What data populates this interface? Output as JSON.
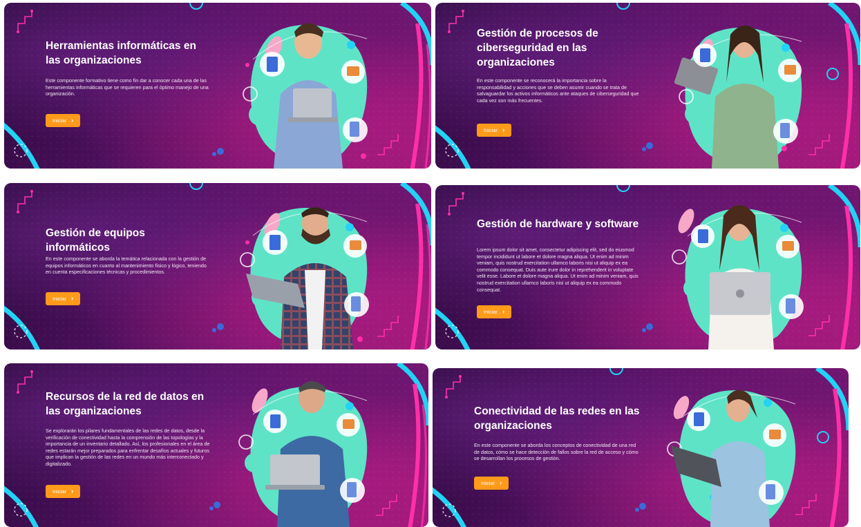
{
  "cards": [
    {
      "title": "Herramientas informáticas en las organizaciones",
      "description": "Este componente formativo tiene como fin dar a conocer cada una de las herramientas informáticas que se requieren para el óptimo manejo de una organización.",
      "button_label": "Iniciar"
    },
    {
      "title": "Gestión de procesos de ciberseguridad en las organizaciones",
      "description": "En este componente se reconocerá la importancia sobre la responsabilidad y acciones que se deben asumir cuando se trata de salvaguardar los activos informáticos ante ataques de ciberseguridad que cada vez son más frecuentes.",
      "button_label": "Iniciar"
    },
    {
      "title": "Gestión de equipos informáticos",
      "description": "En este componente se aborda la temática relacionada con la gestión de equipos informáticos en cuanto al mantenimiento físico y lógico, teniendo en cuenta especificaciones técnicas y procedimientos.",
      "button_label": "Iniciar"
    },
    {
      "title": "Gestión de hardware y software",
      "description": "Lorem ipsum dolor sit amet, consectetur adipiscing elit, sed do eiusmod tempor incididunt ut labore et dolore magna aliqua. Ut enim ad minim veniam, quis nostrud exercitation ullamco laboris nisi ut aliquip ex ea commodo consequat. Duis aute irure dolor in reprehenderit in voluptate velit esse.   Labore et dolore magna aliqua. Ut enim ad minim veniam, quis nostrud exercitation ullamco laboris nisi ut aliquip ex ea commodo consequat.",
      "button_label": "Iniciar"
    },
    {
      "title": "Recursos de la red de datos en las organizaciones",
      "description": "Se explorarán los pilares fundamentales de las redes de datos, desde la verificación de conectividad hasta la comprensión de las topologías y la importancia de un inventario detallado. Así, los profesionales en el área de redes estarán mejor preparados para enfrentar desafíos actuales y futuros que implican la gestión de las redes en un mundo más interconectado y digitalizado.",
      "button_label": "Iniciar"
    },
    {
      "title": "Conectividad de las redes en las organizaciones",
      "description": "En este componente se aborda los conceptos de conectividad de una red de datos, cómo se hace detección de fallos sobre la red de acceso y cómo se desarrollan los procesos de gestión.",
      "button_label": "Iniciar"
    }
  ],
  "colors": {
    "button": "#ff9a1a",
    "blob": "#5fe3c7",
    "neon_pink": "#ff2fa8",
    "neon_cyan": "#22d3f5"
  },
  "icons": [
    "server-badge-icon",
    "hardware-badge-icon",
    "tools-badge-icon",
    "chevron-right-icon"
  ]
}
